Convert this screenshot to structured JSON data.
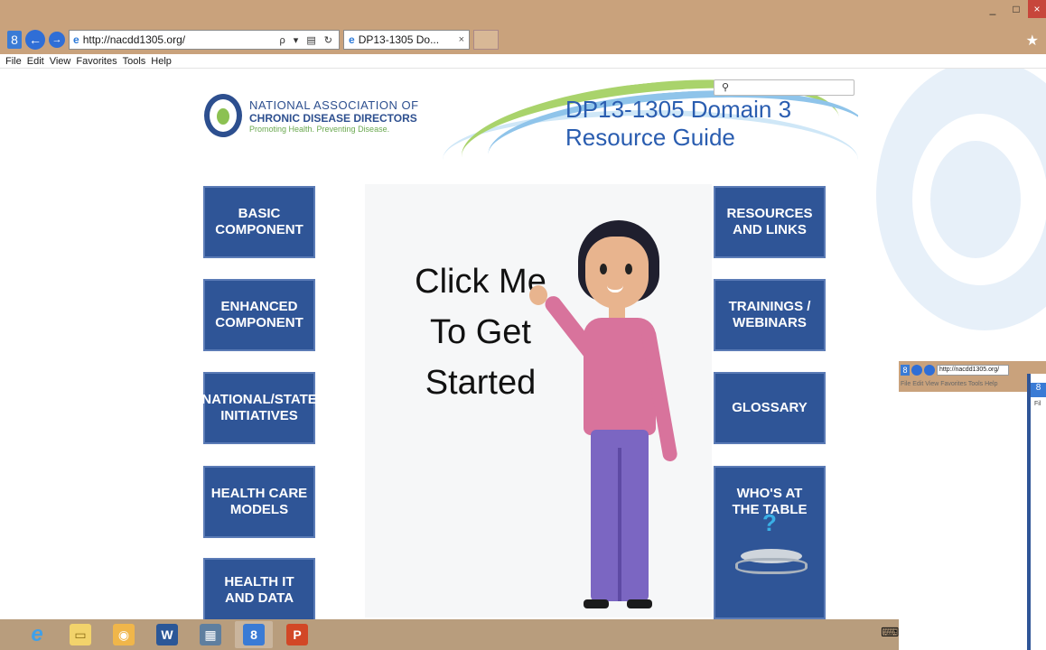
{
  "browser": {
    "address_url": "http://nacdd1305.org/",
    "tab_title": "DP13-1305 Do...",
    "tab_close": "×",
    "address_tools": "ρ ▾ ▤ ↻",
    "window_controls": [
      "_",
      "□",
      "×"
    ],
    "favorite_star": "★",
    "back_label": "←",
    "forward_label": "→",
    "g_label": "8"
  },
  "menubar": [
    "File",
    "Edit",
    "View",
    "Favorites",
    "Tools",
    "Help"
  ],
  "header": {
    "logo_line1": "NATIONAL ASSOCIATION OF",
    "logo_line2": "CHRONIC DISEASE DIRECTORS",
    "logo_line3": "Promoting Health. Preventing Disease.",
    "banner_title": "DP13-1305 Domain 3\nResource Guide",
    "search_icon": "⚲"
  },
  "left_nav": [
    "BASIC\nCOMPONENT",
    "ENHANCED\nCOMPONENT",
    "NATIONAL/STATE\nINITIATIVES",
    "HEALTH CARE\nMODELS",
    "HEALTH IT\nAND DATA"
  ],
  "right_nav": [
    "RESOURCES\nAND LINKS",
    "TRAININGS /\nWEBINARS",
    "GLOSSARY",
    "WHO'S AT\nTHE TABLE"
  ],
  "center": {
    "cta": "Click Me\nTo Get\nStarted",
    "question_mark": "?"
  },
  "thumbnail": {
    "url": "http://nacdd1305.org/",
    "menu": "File  Edit  View  Favorites  Tools  Help",
    "nested_g": "8",
    "nested_menu": "Fil"
  },
  "taskbar": {
    "items": [
      "ie-icon",
      "file-explorer-icon",
      "outlook-icon",
      "word-icon",
      "calculator-icon",
      "chrome-g-icon",
      "powerpoint-icon"
    ],
    "glyphs": [
      "e",
      "▭",
      "◉",
      "W",
      "▦",
      "8",
      "P"
    ],
    "keyboard_icon": "⌨"
  },
  "colors": {
    "button_blue": "#2f5597",
    "title_blue": "#2a5db0",
    "chrome_tan": "#c9a27c"
  }
}
